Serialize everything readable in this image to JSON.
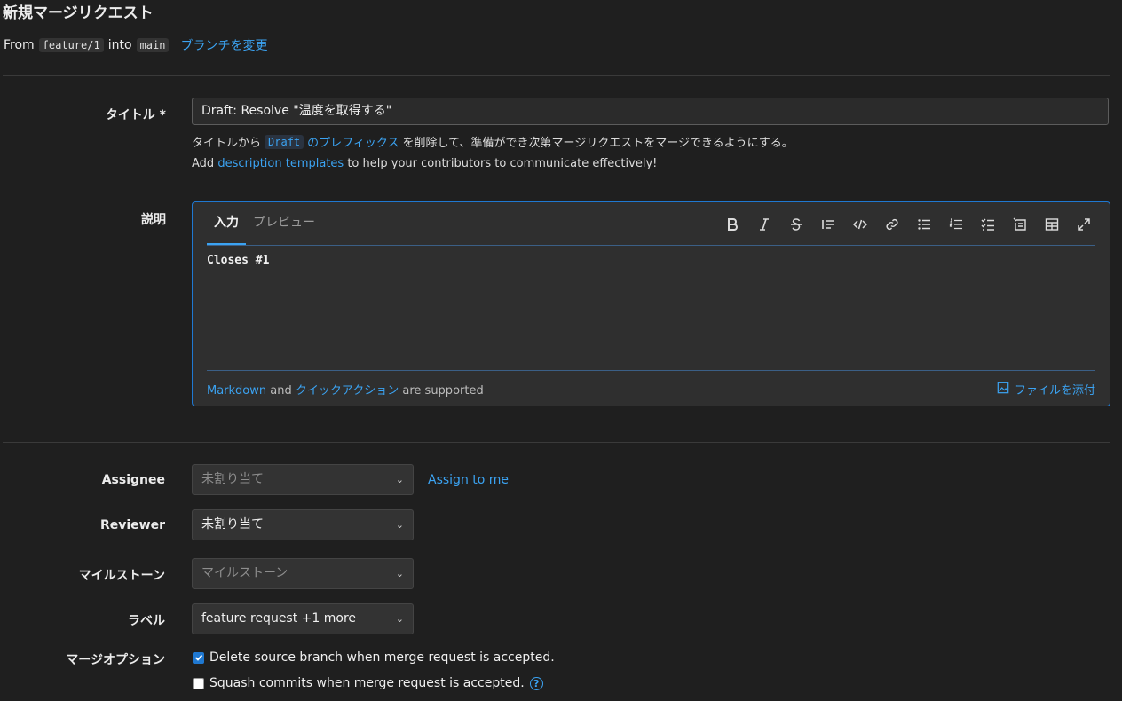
{
  "page": {
    "title": "新規マージリクエスト",
    "from_label": "From",
    "source_branch": "feature/1",
    "into_label": "into",
    "target_branch": "main",
    "change_branches": "ブランチを変更"
  },
  "form": {
    "title_label": "タイトル *",
    "title_value": "Draft: Resolve \"温度を取得する\"",
    "help_prefix1": "タイトルから",
    "help_draft": "Draft",
    "help_prefix_link": "のプレフィックス",
    "help_suffix1": "を削除して、準備ができ次第マージリクエストをマージできるようにする。",
    "help2_add": "Add",
    "help2_link": "description templates",
    "help2_rest": "to help your contributors to communicate effectively!",
    "description_label": "説明",
    "tab_write": "入力",
    "tab_preview": "プレビュー",
    "description_value": "Closes #1",
    "footer_markdown": "Markdown",
    "footer_and": "and",
    "footer_quick": "クイックアクション",
    "footer_supported": "are supported",
    "attach_file": "ファイルを添付",
    "assignee_label": "Assignee",
    "assignee_value": "未割り当て",
    "assign_to_me": "Assign to me",
    "reviewer_label": "Reviewer",
    "reviewer_value": "未割り当て",
    "milestone_label": "マイルストーン",
    "milestone_value": "マイルストーン",
    "labels_label": "ラベル",
    "labels_value": "feature request +1 more",
    "merge_options_label": "マージオプション",
    "delete_source": "Delete source branch when merge request is accepted.",
    "squash": "Squash commits when merge request is accepted.",
    "help_icon": "?"
  },
  "state": {
    "delete_source_checked": true,
    "squash_checked": false
  },
  "toolbar_icons": [
    "bold-icon",
    "italic-icon",
    "strikethrough-icon",
    "quote-icon",
    "code-icon",
    "link-icon",
    "bullet-list-icon",
    "numbered-list-icon",
    "task-list-icon",
    "collapsible-icon",
    "table-icon",
    "fullscreen-icon"
  ],
  "colors": {
    "background": "#1f1f1f",
    "link": "#3ba3f2",
    "editor_border": "#1f78d1"
  }
}
